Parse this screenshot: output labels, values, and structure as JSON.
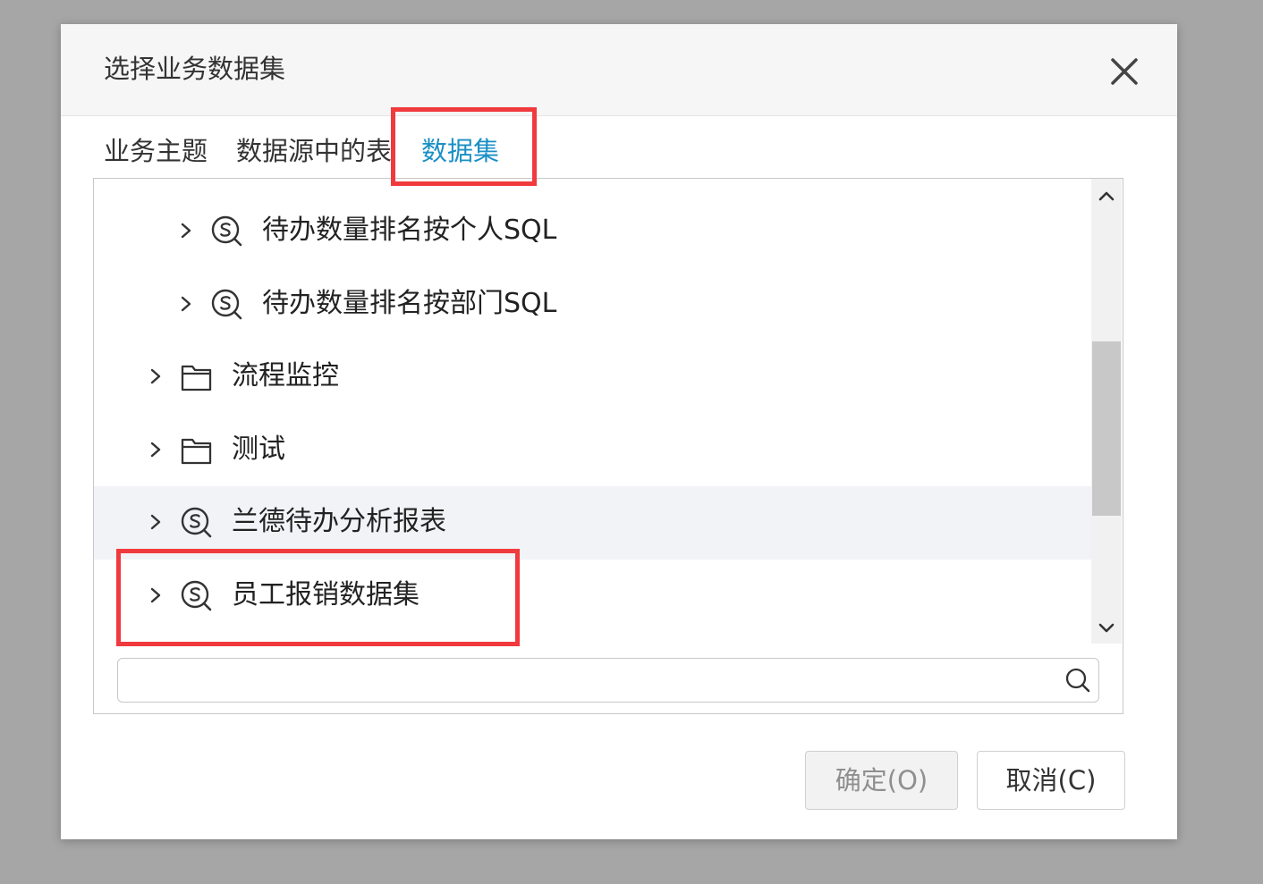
{
  "dialog": {
    "title": "选择业务数据集",
    "close_icon": "close-icon"
  },
  "tabs": [
    {
      "label": "业务主题",
      "active": false
    },
    {
      "label": "数据源中的表",
      "active": false
    },
    {
      "label": "数据集",
      "active": true
    }
  ],
  "tree": {
    "items": [
      {
        "label": "待办数量排名按个人SQL",
        "icon": "sql-dataset-icon",
        "level": 2,
        "hovered": false
      },
      {
        "label": "待办数量排名按部门SQL",
        "icon": "sql-dataset-icon",
        "level": 2,
        "hovered": false
      },
      {
        "label": "流程监控",
        "icon": "folder-icon",
        "level": 1,
        "hovered": false
      },
      {
        "label": "测试",
        "icon": "folder-icon",
        "level": 1,
        "hovered": false
      },
      {
        "label": "兰德待办分析报表",
        "icon": "sql-dataset-icon",
        "level": 1,
        "hovered": true
      },
      {
        "label": "员工报销数据集",
        "icon": "sql-dataset-icon",
        "level": 1,
        "hovered": false
      }
    ]
  },
  "search": {
    "value": "",
    "placeholder": "",
    "icon": "search-icon"
  },
  "buttons": {
    "ok_label": "确定(O)",
    "cancel_label": "取消(C)"
  },
  "colors": {
    "active_tab": "#1b8fc6",
    "highlight_box": "#f03a3e",
    "hover_row": "#f1f3f7"
  }
}
